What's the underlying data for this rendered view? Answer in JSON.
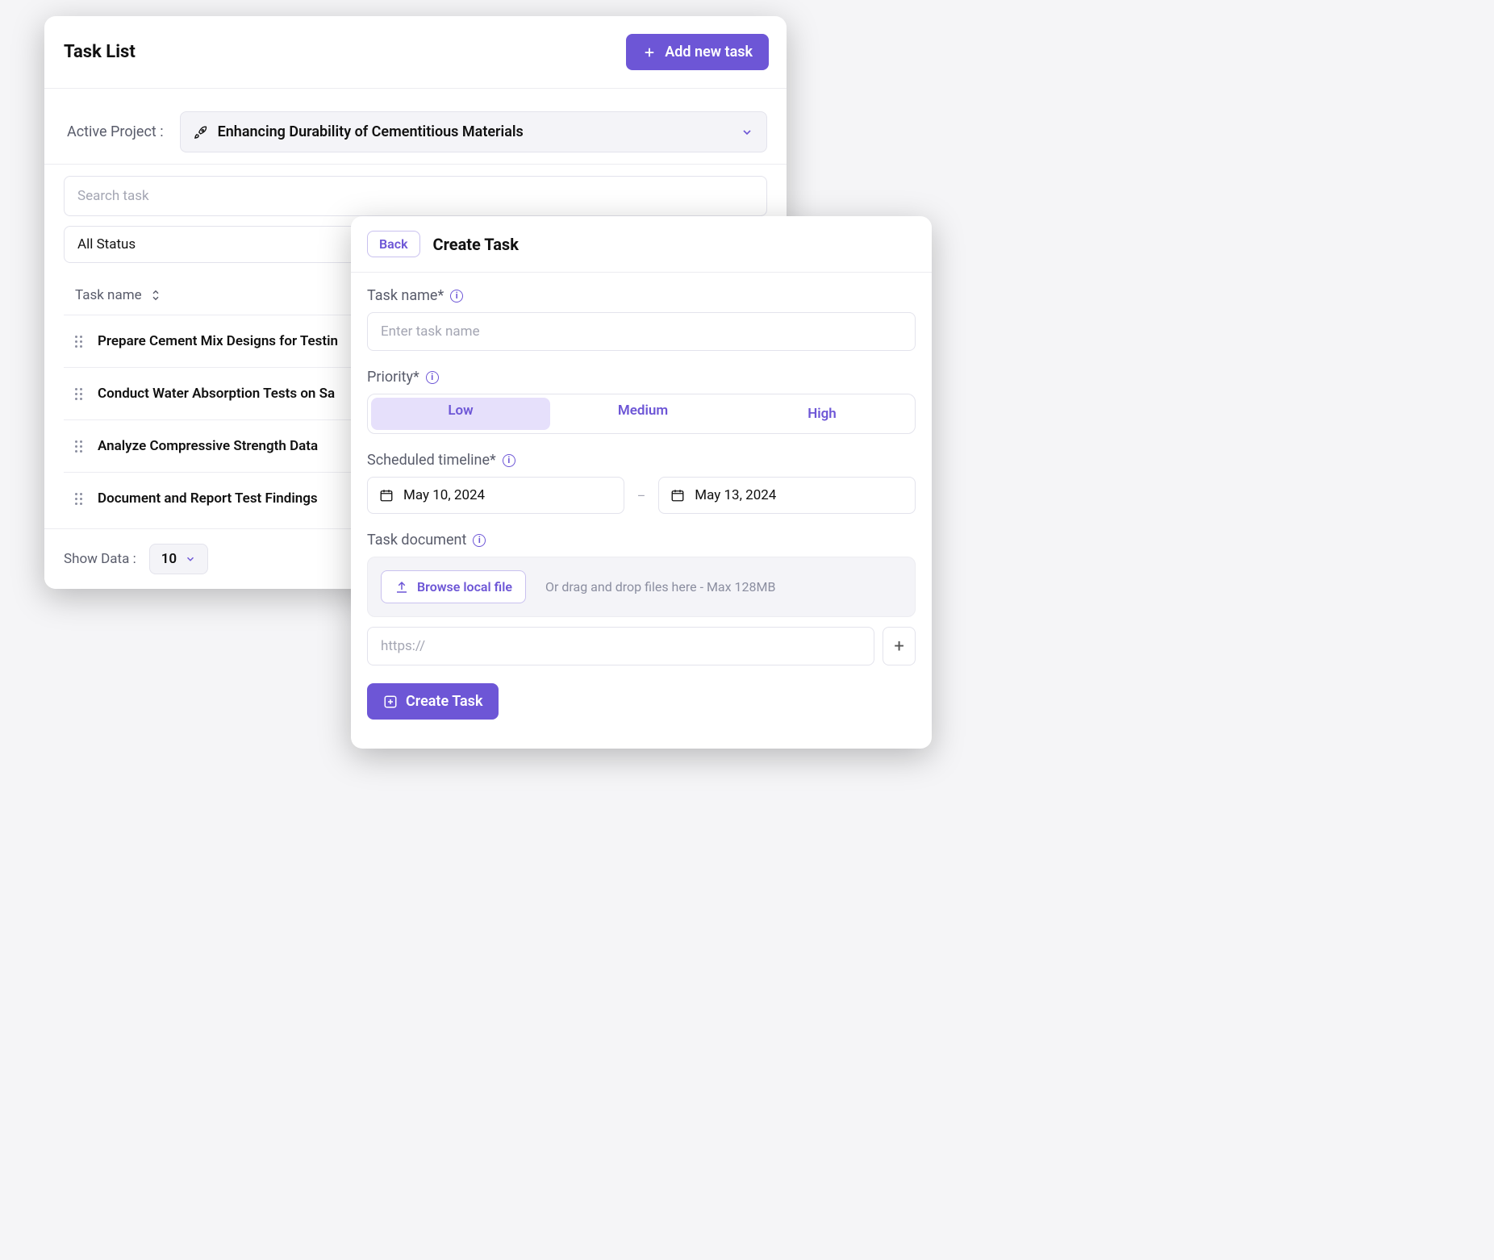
{
  "taskList": {
    "title": "Task List",
    "addButton": "Add new task",
    "activeProjectLabel": "Active Project :",
    "activeProjectValue": "Enhancing Durability of Cementitious Materials",
    "searchPlaceholder": "Search task",
    "statusFilter": "All Status",
    "columnHeader": "Task name",
    "rows": [
      "Prepare Cement Mix Designs for Testin",
      "Conduct Water Absorption Tests on Sa",
      "Analyze Compressive Strength Data",
      "Document and Report Test Findings"
    ],
    "showDataLabel": "Show Data :",
    "pageSize": "10"
  },
  "createTask": {
    "backLabel": "Back",
    "title": "Create Task",
    "taskNameLabel": "Task name*",
    "taskNamePlaceholder": "Enter task name",
    "priorityLabel": "Priority*",
    "priorityOptions": [
      "Low",
      "Medium",
      "High"
    ],
    "prioritySelected": "Low",
    "timelineLabel": "Scheduled timeline*",
    "startDate": "May 10, 2024",
    "endDate": "May 13, 2024",
    "documentLabel": "Task document",
    "browseLabel": "Browse local file",
    "dragHint": "Or drag and drop files here - Max 128MB",
    "urlPlaceholder": "https://",
    "submitLabel": "Create Task"
  }
}
